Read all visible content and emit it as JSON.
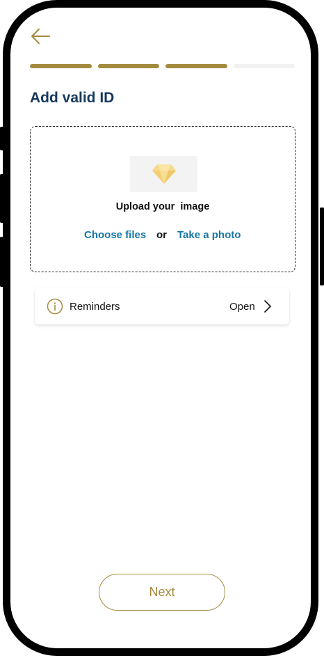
{
  "colors": {
    "accent": "#a48a3e",
    "title": "#17395e",
    "link": "#1577a8",
    "track": "#f2f2f2"
  },
  "header": {
    "back_icon": "arrow-left-icon",
    "progress": {
      "total_steps": 4,
      "completed_steps": 3
    }
  },
  "page": {
    "title": "Add valid ID"
  },
  "upload": {
    "preview_icon": "diamond-icon",
    "prompt": "Upload your  image",
    "choose_files": "Choose files",
    "separator": "or",
    "take_photo": "Take a photo"
  },
  "reminders": {
    "icon": "info-icon",
    "label": "Reminders",
    "action": "Open",
    "chevron": "chevron-right-icon"
  },
  "footer": {
    "next_label": "Next"
  }
}
